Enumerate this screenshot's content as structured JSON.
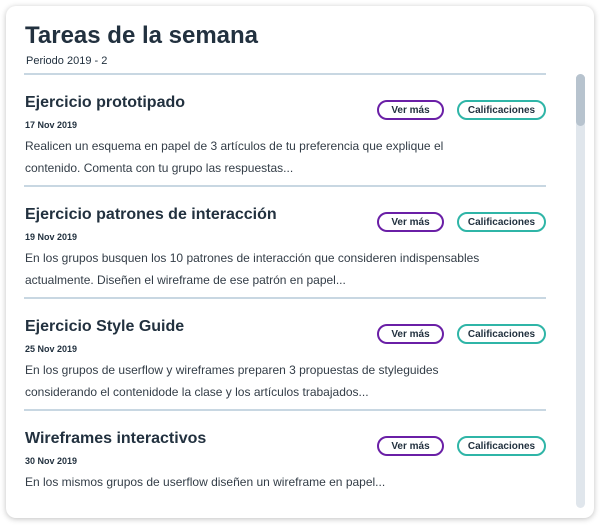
{
  "header": {
    "title": "Tareas de la semana",
    "period": "Periodo 2019 - 2"
  },
  "tasks": [
    {
      "title": "Ejercicio prototipado",
      "date": "17 Nov 2019",
      "description": "Realicen un esquema en papel de 3 artículos de tu preferencia que explique el contenido. Comenta con tu grupo las respuestas...",
      "more_label": "Ver más",
      "grades_label": "Calificaciones"
    },
    {
      "title": "Ejercicio patrones de interacción",
      "date": "19 Nov 2019",
      "description": "En los grupos busquen los 10 patrones de interacción que consideren indispensables actualmente. Diseñen el wireframe de ese patrón en papel...",
      "more_label": "Ver más",
      "grades_label": "Calificaciones"
    },
    {
      "title": "Ejercicio Style Guide",
      "date": "25 Nov 2019",
      "description": "En los grupos de userflow y wireframes preparen 3 propuestas de styleguides considerando el contenidode la clase y los artículos trabajados...",
      "more_label": "Ver más",
      "grades_label": "Calificaciones"
    },
    {
      "title": "Wireframes interactivos",
      "date": "30 Nov 2019",
      "description": "En los mismos grupos de userflow diseñen un wireframe en papel...",
      "more_label": "Ver más",
      "grades_label": "Calificaciones"
    }
  ],
  "colors": {
    "text": "#22313f",
    "divider": "#c8d7e2",
    "more_button_border": "#6a1fa6",
    "grades_button_border": "#2fb5a7",
    "scroll_track": "#e0e6ec",
    "scroll_thumb": "#b7c3ce"
  }
}
